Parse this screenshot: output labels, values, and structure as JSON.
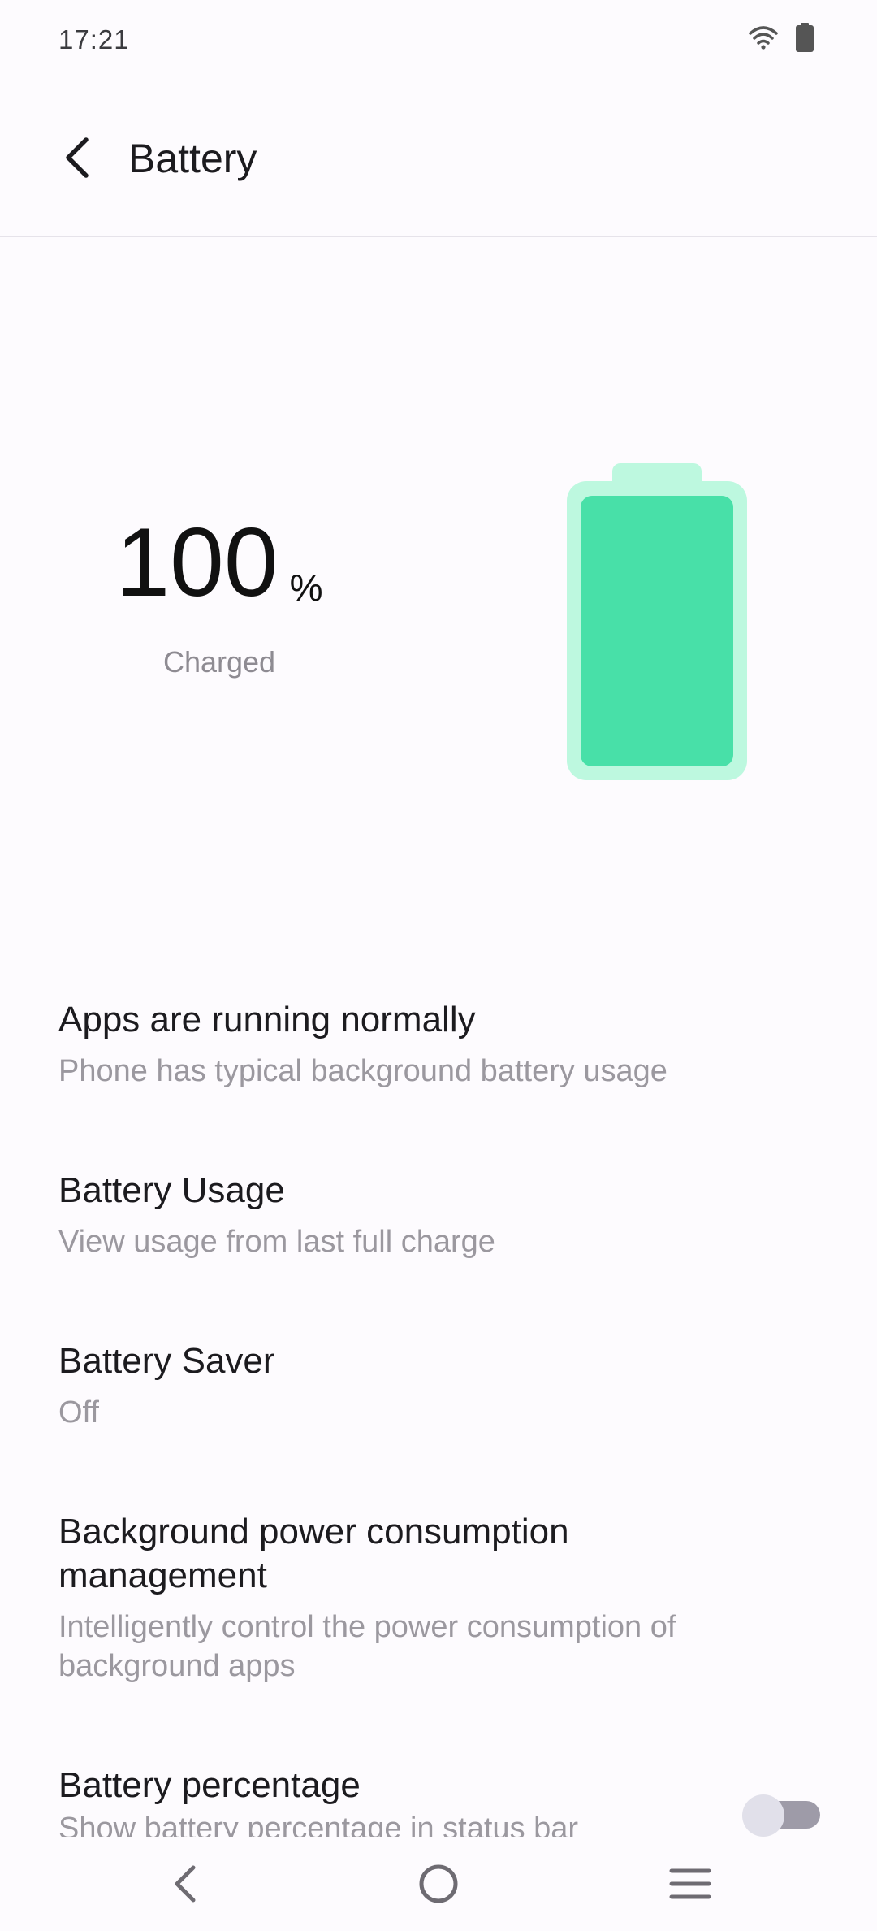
{
  "status_bar": {
    "time": "17:21",
    "icons": [
      "wifi-icon",
      "battery-icon"
    ]
  },
  "app_bar": {
    "title": "Battery",
    "back_icon": "chevron-left-icon"
  },
  "battery": {
    "level": "100",
    "unit": "%",
    "status": "Charged",
    "fill_fraction": 1.0,
    "colors": {
      "fill": "#48e0a8",
      "outline": "#bdf8df"
    }
  },
  "items": [
    {
      "title": "Apps are running normally",
      "summary": "Phone has typical background battery usage"
    },
    {
      "title": "Battery Usage",
      "summary": "View usage from last full charge"
    },
    {
      "title": "Battery Saver",
      "summary": "Off"
    },
    {
      "title": "Background power consumption management",
      "summary": "Intelligently control the power consumption of background apps"
    },
    {
      "title": "Battery percentage",
      "summary": "Show battery percentage in status bar"
    }
  ],
  "battery_percentage_toggle": {
    "on": false
  },
  "nav_bar": {
    "back": "back-icon",
    "home": "home-icon",
    "recents": "menu-icon"
  }
}
